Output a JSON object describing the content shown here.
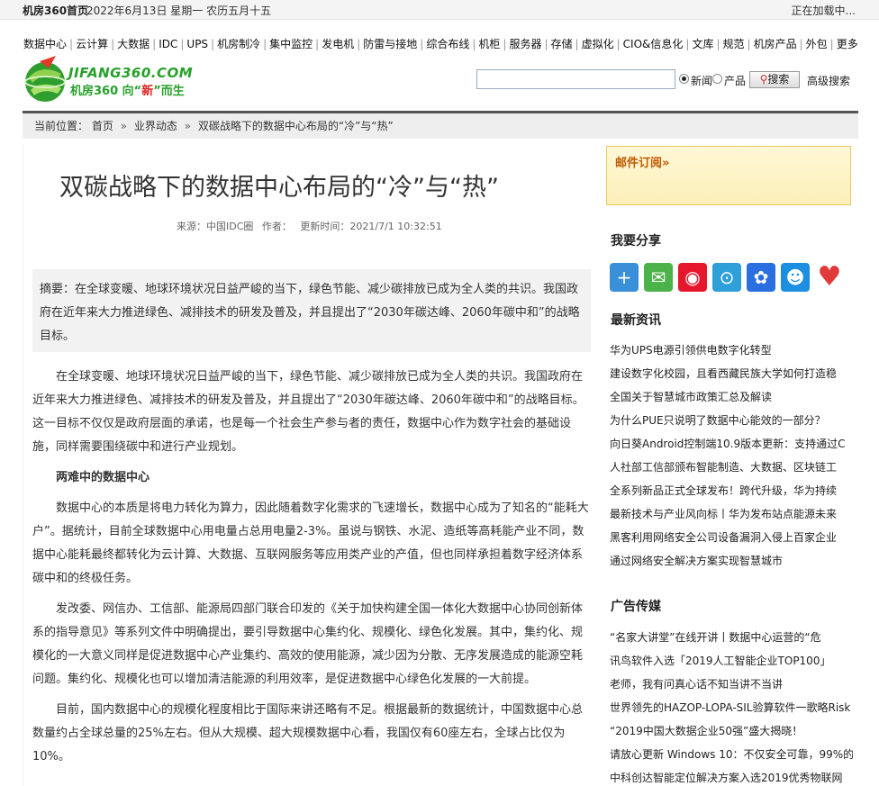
{
  "topbar": {
    "home": "机房360首页",
    "date": "2022年6月13日  星期一  农历五月十五",
    "loading": "正在加载中..."
  },
  "nav": [
    "数据中心",
    "云计算",
    "大数据",
    "IDC",
    "UPS",
    "机房制冷",
    "集中监控",
    "发电机",
    "防雷与接地",
    "综合布线",
    "机柜",
    "服务器",
    "存储",
    "虚拟化",
    "CIO&信息化",
    "文库",
    "规范",
    "机房产品",
    "外包",
    "更多"
  ],
  "logo": {
    "en": "JIFANG360.COM",
    "cn_a": "机房360 向“",
    "cn_b": "新",
    "cn_c": "”而生"
  },
  "search": {
    "placeholder": "",
    "opt_news": "新闻",
    "opt_product": "产品",
    "button": "搜索",
    "advanced": "高级搜索"
  },
  "breadcrumb": {
    "label": "当前位置：",
    "home": "首页",
    "section": "业界动态",
    "current": "双碳战略下的数据中心布局的“冷”与“热”"
  },
  "article": {
    "title": "双碳战略下的数据中心布局的“冷”与“热”",
    "source": "来源：中国IDC圈",
    "author": "作者：",
    "updated": "更新时间：2021/7/1 10:32:51",
    "summary": "摘要：在全球变暖、地球环境状况日益严峻的当下，绿色节能、减少碳排放已成为全人类的共识。我国政府在近年来大力推进绿色、减排技术的研发及普及，并且提出了“2030年碳达峰、2060年碳中和”的战略目标。",
    "p1": "在全球变暖、地球环境状况日益严峻的当下，绿色节能、减少碳排放已成为全人类的共识。我国政府在近年来大力推进绿色、减排技术的研发及普及，并且提出了“2030年碳达峰、2060年碳中和”的战略目标。这一目标不仅仅是政府层面的承诺，也是每一个社会生产参与者的责任，数据中心作为数字社会的基础设施，同样需要围绕碳中和进行产业规划。",
    "sub1": "两难中的数据中心",
    "p2": "数据中心的本质是将电力转化为算力，因此随着数字化需求的飞速增长，数据中心成为了知名的“能耗大户”。据统计，目前全球数据中心用电量占总用电量2-3%。虽说与钢铁、水泥、造纸等高耗能产业不同，数据中心能耗最终都转化为云计算、大数据、互联网服务等应用类产业的产值，但也同样承担着数字经济体系碳中和的终极任务。",
    "p3": "发改委、网信办、工信部、能源局四部门联合印发的《关于加快构建全国一体化大数据中心协同创新体系的指导意见》等系列文件中明确提出，要引导数据中心集约化、规模化、绿色化发展。其中，集约化、规模化的一大意义同样是促进数据中心产业集约、高效的使用能源，减少因为分散、无序发展造成的能源空耗问题。集约化、规模化也可以增加清洁能源的利用效率，是促进数据中心绿色化发展的一大前提。",
    "p4": "目前，国内数据中心的规模化程度相比于国际来讲还略有不足。根据最新的数据统计，中国数据中心总数量约占全球总量的25%左右。但从大规模、超大规模数据中心看，我国仅有60座左右，全球占比仅为10%。"
  },
  "sidebar": {
    "mail_title": "邮件订阅»",
    "share_title": "我要分享",
    "news_title": "最新资讯",
    "news": [
      "华为UPS电源引领供电数字化转型",
      "建设数字化校园，且看西藏民族大学如何打造稳",
      "全国关于智慧城市政策汇总及解读",
      "为什么PUE只说明了数据中心能效的一部分？",
      "向日葵Android控制端10.9版本更新：支持通过C",
      "人社部工信部颁布智能制造、大数据、区块链工",
      "全系列新品正式全球发布！跨代升级，华为持续",
      "最新技术与产业风向标丨华为发布站点能源未来",
      "黑客利用网络安全公司设备漏洞入侵上百家企业",
      "通过网络安全解决方案实现智慧城市"
    ],
    "ads_title": "广告传媒",
    "ads": [
      "“名家大讲堂”在线开讲丨数据中心运营的“危",
      "讯鸟软件入选「2019人工智能企业TOP100」",
      "老师，我有问真心话不知当讲不当讲",
      "世界领先的HAZOP-LOPA-SIL验算软件一歌略Risk",
      "“2019中国大数据企业50强”盛大揭晓！",
      "请放心更新 Windows 10：不仅安全可靠，99%的",
      "中科创达智能定位解决方案入选2019优秀物联网"
    ],
    "share_icons": [
      {
        "name": "plus-share-icon",
        "color": "#3a8fd9"
      },
      {
        "name": "wechat-icon",
        "color": "#4cb34a"
      },
      {
        "name": "weibo-icon",
        "color": "#e6162d"
      },
      {
        "name": "tencent-weibo-icon",
        "color": "#2e9fd8"
      },
      {
        "name": "baidu-icon",
        "color": "#2a6fe0"
      },
      {
        "name": "qq-icon",
        "color": "#1d8fe0"
      },
      {
        "name": "heart-like-icon",
        "color": "#e23a3a"
      }
    ]
  }
}
